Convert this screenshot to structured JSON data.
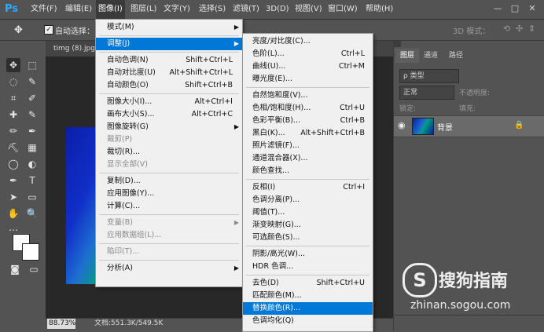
{
  "app": {
    "logo": "Ps"
  },
  "menubar": {
    "items": [
      {
        "label": "文件(F)",
        "active": false
      },
      {
        "label": "编辑(E)",
        "active": false
      },
      {
        "label": "图像(I)",
        "active": true
      },
      {
        "label": "图层(L)",
        "active": false
      },
      {
        "label": "文字(Y)",
        "active": false
      },
      {
        "label": "选择(S)",
        "active": false
      },
      {
        "label": "滤镜(T)",
        "active": false
      },
      {
        "label": "3D(D)",
        "active": false
      },
      {
        "label": "视图(V)",
        "active": false
      },
      {
        "label": "窗口(W)",
        "active": false
      },
      {
        "label": "帮助(H)",
        "active": false
      }
    ],
    "window_controls": [
      "—",
      "□",
      "✕"
    ]
  },
  "options": {
    "auto_select_label": "自动选择：",
    "checked": true,
    "mode_label": "3D 模式："
  },
  "document": {
    "tab_label": "timg (8).jpg",
    "zoom": "88.73%",
    "info": "文档:551.3K/549.5K"
  },
  "layers_panel": {
    "tabs": [
      "图层",
      "通道",
      "路径"
    ],
    "active_tab": 0,
    "kind_filter": "ρ 类型",
    "blend_mode": "正常",
    "opacity_label": "不透明度:",
    "lock_label": "锁定:",
    "fill_label": "填充:",
    "layer_name": "背景"
  },
  "image_menu": {
    "items": [
      {
        "label": "模式(M)",
        "shortcut": "",
        "submenu": true,
        "disabled": false,
        "highlight": false
      },
      {
        "sep": true
      },
      {
        "label": "调整(J)",
        "shortcut": "",
        "submenu": true,
        "disabled": false,
        "highlight": true
      },
      {
        "sep": true
      },
      {
        "label": "自动色调(N)",
        "shortcut": "Shift+Ctrl+L",
        "submenu": false,
        "disabled": false,
        "highlight": false
      },
      {
        "label": "自动对比度(U)",
        "shortcut": "Alt+Shift+Ctrl+L",
        "submenu": false,
        "disabled": false,
        "highlight": false
      },
      {
        "label": "自动颜色(O)",
        "shortcut": "Shift+Ctrl+B",
        "submenu": false,
        "disabled": false,
        "highlight": false
      },
      {
        "sep": true
      },
      {
        "label": "图像大小(I)...",
        "shortcut": "Alt+Ctrl+I",
        "submenu": false,
        "disabled": false,
        "highlight": false
      },
      {
        "label": "画布大小(S)...",
        "shortcut": "Alt+Ctrl+C",
        "submenu": false,
        "disabled": false,
        "highlight": false
      },
      {
        "label": "图像旋转(G)",
        "shortcut": "",
        "submenu": true,
        "disabled": false,
        "highlight": false
      },
      {
        "label": "裁剪(P)",
        "shortcut": "",
        "submenu": false,
        "disabled": true,
        "highlight": false
      },
      {
        "label": "裁切(R)...",
        "shortcut": "",
        "submenu": false,
        "disabled": false,
        "highlight": false
      },
      {
        "label": "显示全部(V)",
        "shortcut": "",
        "submenu": false,
        "disabled": true,
        "highlight": false
      },
      {
        "sep": true
      },
      {
        "label": "复制(D)...",
        "shortcut": "",
        "submenu": false,
        "disabled": false,
        "highlight": false
      },
      {
        "label": "应用图像(Y)...",
        "shortcut": "",
        "submenu": false,
        "disabled": false,
        "highlight": false
      },
      {
        "label": "计算(C)...",
        "shortcut": "",
        "submenu": false,
        "disabled": false,
        "highlight": false
      },
      {
        "sep": true
      },
      {
        "label": "变量(B)",
        "shortcut": "",
        "submenu": true,
        "disabled": true,
        "highlight": false
      },
      {
        "label": "应用数据组(L)...",
        "shortcut": "",
        "submenu": false,
        "disabled": true,
        "highlight": false
      },
      {
        "sep": true
      },
      {
        "label": "陷印(T)...",
        "shortcut": "",
        "submenu": false,
        "disabled": true,
        "highlight": false
      },
      {
        "sep": true
      },
      {
        "label": "分析(A)",
        "shortcut": "",
        "submenu": true,
        "disabled": false,
        "highlight": false
      }
    ]
  },
  "adjust_menu": {
    "items": [
      {
        "label": "亮度/对比度(C)...",
        "shortcut": "",
        "highlight": false
      },
      {
        "label": "色阶(L)...",
        "shortcut": "Ctrl+L",
        "highlight": false
      },
      {
        "label": "曲线(U)...",
        "shortcut": "Ctrl+M",
        "highlight": false
      },
      {
        "label": "曝光度(E)...",
        "shortcut": "",
        "highlight": false
      },
      {
        "sep": true
      },
      {
        "label": "自然饱和度(V)...",
        "shortcut": "",
        "highlight": false
      },
      {
        "label": "色相/饱和度(H)...",
        "shortcut": "Ctrl+U",
        "highlight": false
      },
      {
        "label": "色彩平衡(B)...",
        "shortcut": "Ctrl+B",
        "highlight": false
      },
      {
        "label": "黑白(K)...",
        "shortcut": "Alt+Shift+Ctrl+B",
        "highlight": false
      },
      {
        "label": "照片滤镜(F)...",
        "shortcut": "",
        "highlight": false
      },
      {
        "label": "通道混合器(X)...",
        "shortcut": "",
        "highlight": false
      },
      {
        "label": "颜色查找...",
        "shortcut": "",
        "highlight": false
      },
      {
        "sep": true
      },
      {
        "label": "反相(I)",
        "shortcut": "Ctrl+I",
        "highlight": false
      },
      {
        "label": "色调分离(P)...",
        "shortcut": "",
        "highlight": false
      },
      {
        "label": "阈值(T)...",
        "shortcut": "",
        "highlight": false
      },
      {
        "label": "渐变映射(G)...",
        "shortcut": "",
        "highlight": false
      },
      {
        "label": "可选颜色(S)...",
        "shortcut": "",
        "highlight": false
      },
      {
        "sep": true
      },
      {
        "label": "阴影/高光(W)...",
        "shortcut": "",
        "highlight": false
      },
      {
        "label": "HDR 色调...",
        "shortcut": "",
        "highlight": false
      },
      {
        "sep": true
      },
      {
        "label": "去色(D)",
        "shortcut": "Shift+Ctrl+U",
        "highlight": false
      },
      {
        "label": "匹配颜色(M)...",
        "shortcut": "",
        "highlight": false
      },
      {
        "label": "替换颜色(R)...",
        "shortcut": "",
        "highlight": true
      },
      {
        "label": "色调均化(Q)",
        "shortcut": "",
        "highlight": false
      }
    ]
  },
  "watermark": {
    "logo_letter": "S",
    "brand": "搜狗指南",
    "url": "zhinan.sogou.com"
  },
  "colors": {
    "highlight": "#0078d7",
    "menu_bg": "#f0f0f0",
    "ps_blue": "#31a8ff"
  }
}
